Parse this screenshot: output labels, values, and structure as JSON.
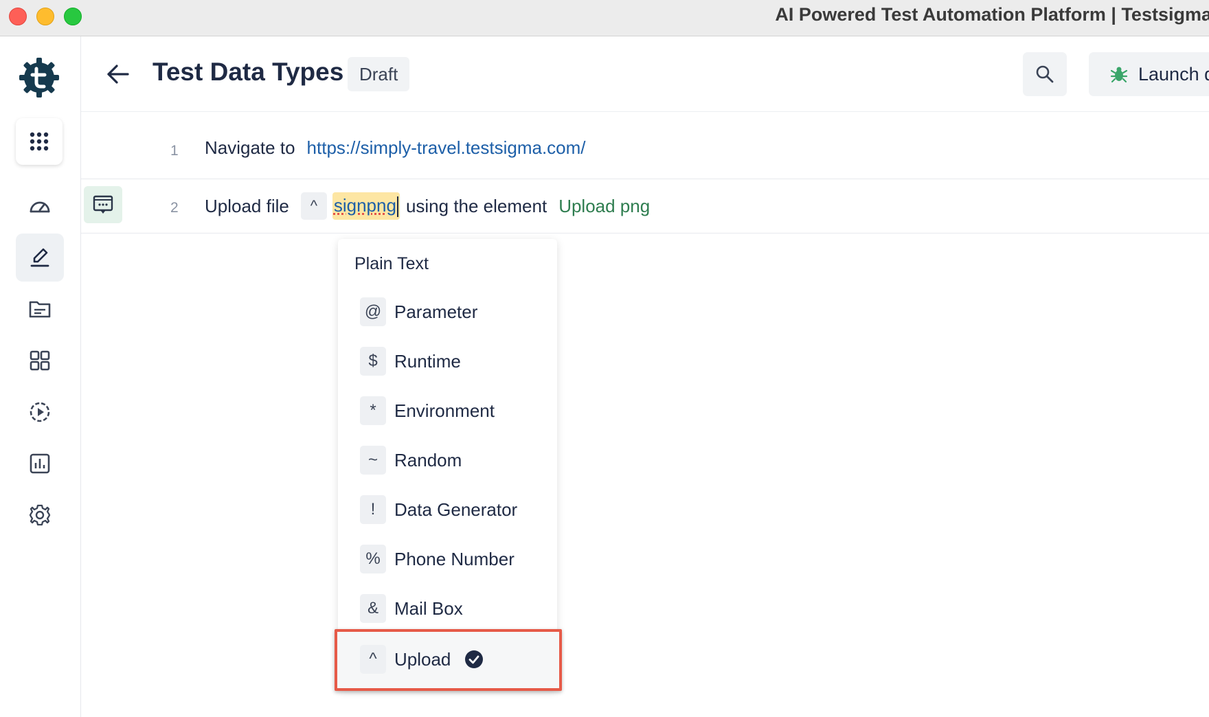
{
  "window": {
    "title": "AI Powered Test Automation Platform | Testsigma"
  },
  "sidebar": {
    "items": [
      {
        "name": "apps-grid-icon"
      },
      {
        "name": "dashboard-icon"
      },
      {
        "name": "test-cases-icon",
        "active": true
      },
      {
        "name": "test-data-icon"
      },
      {
        "name": "elements-icon"
      },
      {
        "name": "runs-icon"
      },
      {
        "name": "reports-icon"
      },
      {
        "name": "settings-icon"
      }
    ]
  },
  "header": {
    "title": "Test Data Types",
    "status": "Draft",
    "launch_label": "Launch d"
  },
  "steps": [
    {
      "number": "1",
      "action": "Navigate to",
      "url": "https://simply-travel.testsigma.com/"
    },
    {
      "number": "2",
      "action": "Upload file",
      "type_symbol": "^",
      "value": "signpng",
      "connector": "using the element",
      "element": "Upload png"
    }
  ],
  "dropdown": {
    "plain_text": "Plain Text",
    "items": [
      {
        "symbol": "@",
        "label": "Parameter"
      },
      {
        "symbol": "$",
        "label": "Runtime"
      },
      {
        "symbol": "*",
        "label": "Environment"
      },
      {
        "symbol": "~",
        "label": "Random"
      },
      {
        "symbol": "!",
        "label": "Data Generator"
      },
      {
        "symbol": "%",
        "label": "Phone Number"
      },
      {
        "symbol": "&",
        "label": "Mail Box"
      },
      {
        "symbol": "^",
        "label": "Upload",
        "selected": true
      }
    ]
  },
  "colors": {
    "accent_green": "#2e7d4f",
    "link_blue": "#1d5fa8",
    "highlight_red": "#e65a48",
    "value_yellow": "#fde6a3"
  }
}
